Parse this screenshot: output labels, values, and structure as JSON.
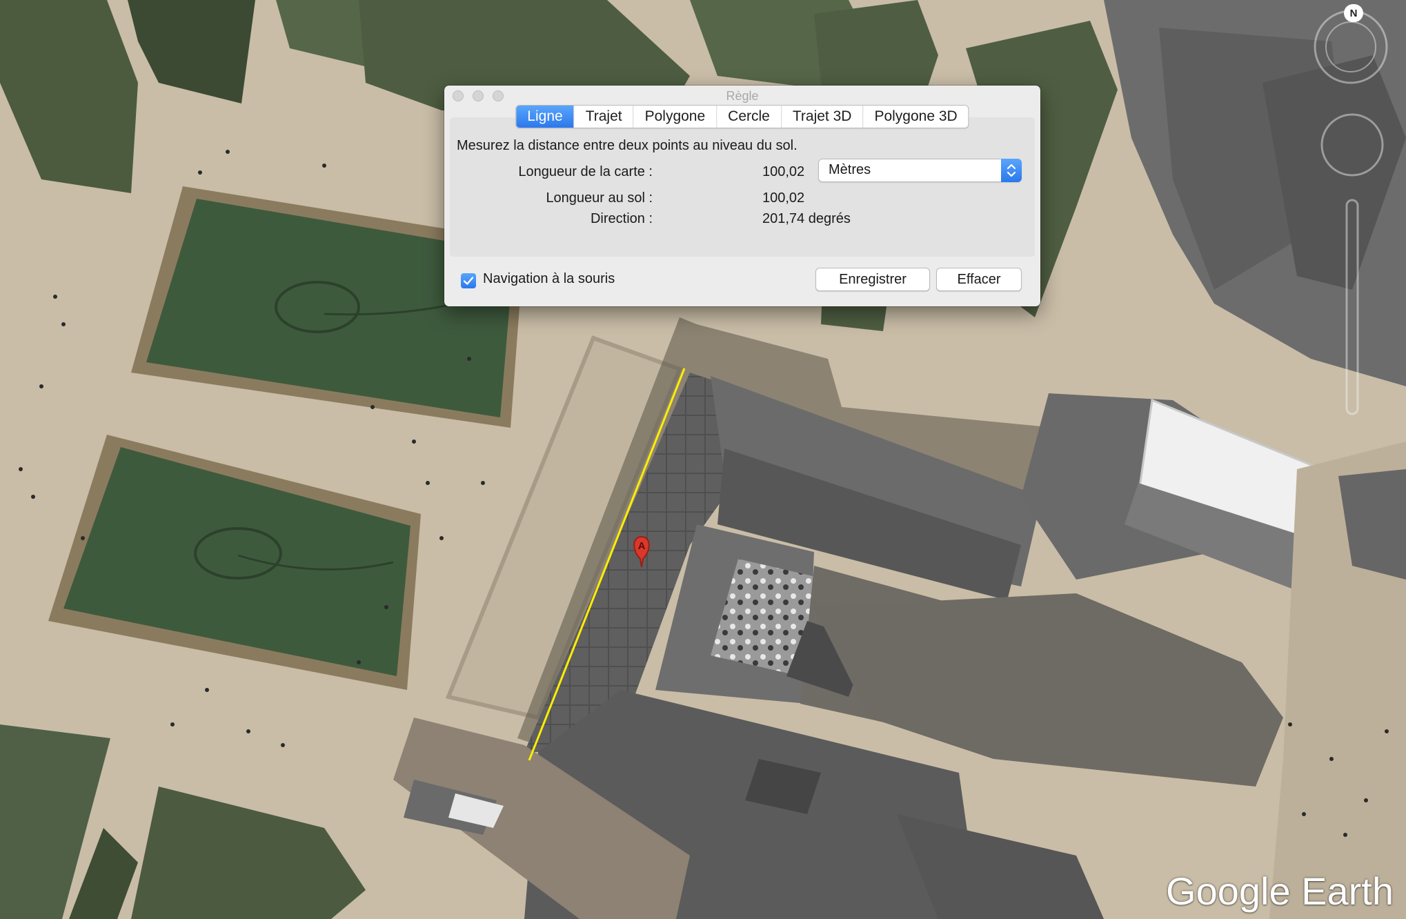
{
  "dialog": {
    "title": "Règle",
    "tabs": [
      "Ligne",
      "Trajet",
      "Polygone",
      "Cercle",
      "Trajet 3D",
      "Polygone 3D"
    ],
    "active_tab": "Ligne",
    "description": "Mesurez la distance entre deux points au niveau du sol.",
    "map_length_label": "Longueur de la carte :",
    "map_length_value": "100,02",
    "unit_select": "Mètres",
    "ground_length_label": "Longueur au sol :",
    "ground_length_value": "100,02",
    "direction_label": "Direction :",
    "direction_value": "201,74 degrés",
    "mouse_nav_label": "Navigation à la souris",
    "mouse_nav_checked": true,
    "save_label": "Enregistrer",
    "clear_label": "Effacer"
  },
  "map": {
    "marker_label": "A",
    "compass_label": "N",
    "measure_line_color": "#ffee00",
    "marker_color": "#d9382c"
  },
  "brand": "Google Earth"
}
